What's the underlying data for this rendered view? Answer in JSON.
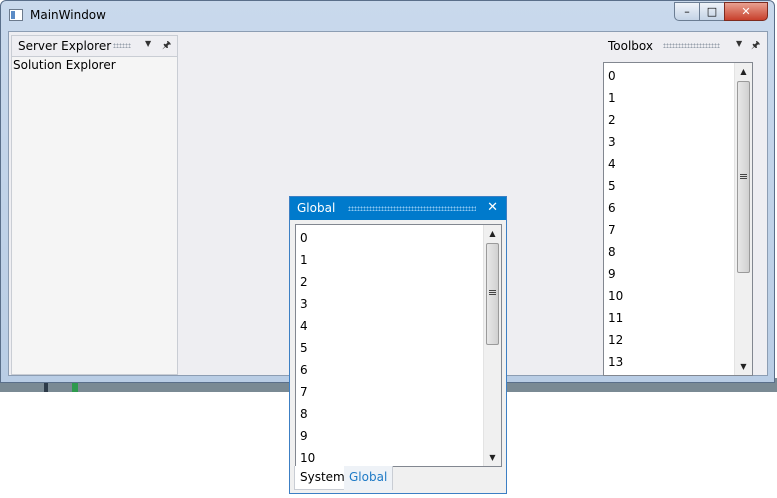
{
  "window": {
    "title": "MainWindow"
  },
  "left_pane": {
    "title": "Server Explorer",
    "body": "Solution Explorer"
  },
  "right_pane": {
    "title": "Toolbox",
    "items": [
      "0",
      "1",
      "2",
      "3",
      "4",
      "5",
      "6",
      "7",
      "8",
      "9",
      "10",
      "11",
      "12",
      "13"
    ]
  },
  "float_window": {
    "title": "Global",
    "items": [
      "0",
      "1",
      "2",
      "3",
      "4",
      "5",
      "6",
      "7",
      "8",
      "9",
      "10"
    ],
    "tabs": [
      {
        "label": "System",
        "selected": false
      },
      {
        "label": "Global",
        "selected": true
      }
    ]
  },
  "colors": {
    "accent": "#007acc",
    "close_button": "#c8402c",
    "selected_tab_text": "#1e7ac6"
  },
  "icons": {
    "minimize": "minimize-icon",
    "maximize": "maximize-icon",
    "close": "close-icon",
    "pane_dropdown": "chevron-down-icon",
    "pin": "pin-icon",
    "scroll_up": "arrow-up-icon",
    "scroll_down": "arrow-down-icon"
  }
}
